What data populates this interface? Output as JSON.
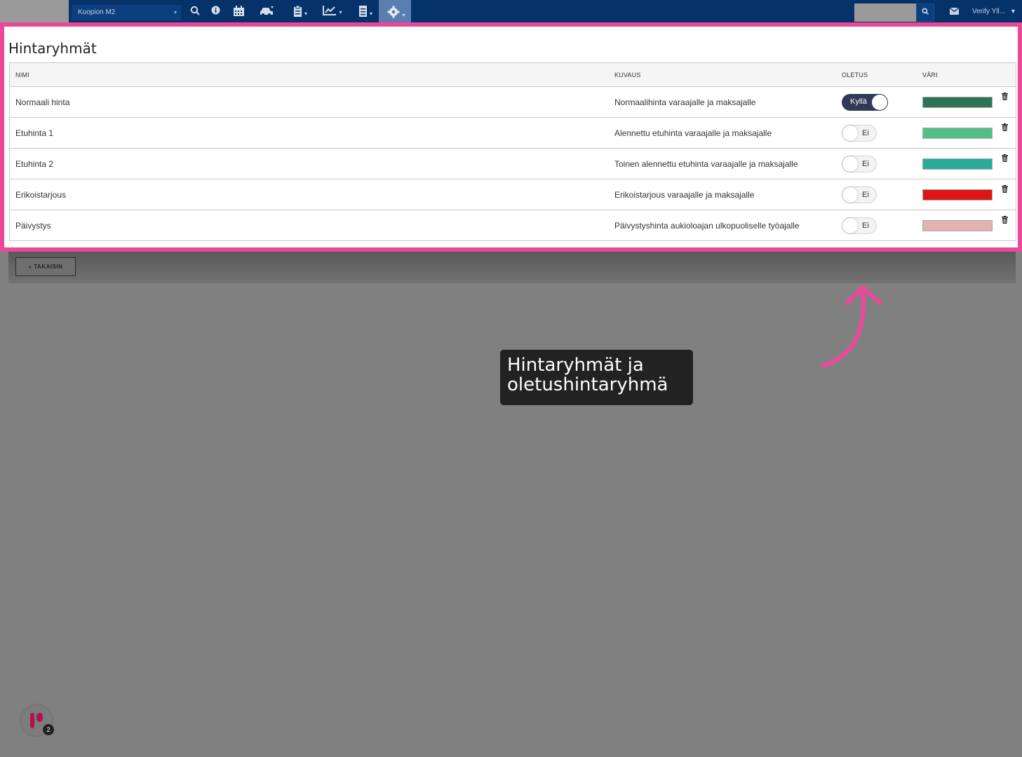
{
  "navbar": {
    "location_select": "Kuopion M2",
    "search_placeholder": "",
    "user_label": "Verify Yll..."
  },
  "panel": {
    "title": "Hintaryhmät"
  },
  "table": {
    "headers": {
      "name": "NIMI",
      "description": "KUVAUS",
      "default": "OLETUS",
      "color": "VÄRI"
    },
    "rows": [
      {
        "name": "Normaali hinta",
        "description": "Normaalihinta varaajalle ja maksajalle",
        "default": "Kyllä",
        "is_default": true,
        "color": "#2e7358"
      },
      {
        "name": "Etuhinta 1",
        "description": "Alennettu etuhinta varaajalle ja maksajalle",
        "default": "Ei",
        "is_default": false,
        "color": "#53bf84"
      },
      {
        "name": "Etuhinta 2",
        "description": "Toinen alennettu etuhinta varaajalle ja maksajalle",
        "default": "Ei",
        "is_default": false,
        "color": "#2aaa9b"
      },
      {
        "name": "Erikoistarjous",
        "description": "Erikoistarjous varaajalle ja maksajalle",
        "default": "Ei",
        "is_default": false,
        "color": "#e01414"
      },
      {
        "name": "Päivystys",
        "description": "Päivystyshinta aukioloajan ulkopuoliselle työajalle",
        "default": "Ei",
        "is_default": false,
        "color": "#e0b2b2"
      }
    ]
  },
  "back_button": "TAKAISIN",
  "tooltip": "Hintaryhmät ja oletushintaryhmä",
  "widget_badge": "2",
  "colors": {
    "navbar": "#06326a",
    "highlight": "#ec4899"
  }
}
